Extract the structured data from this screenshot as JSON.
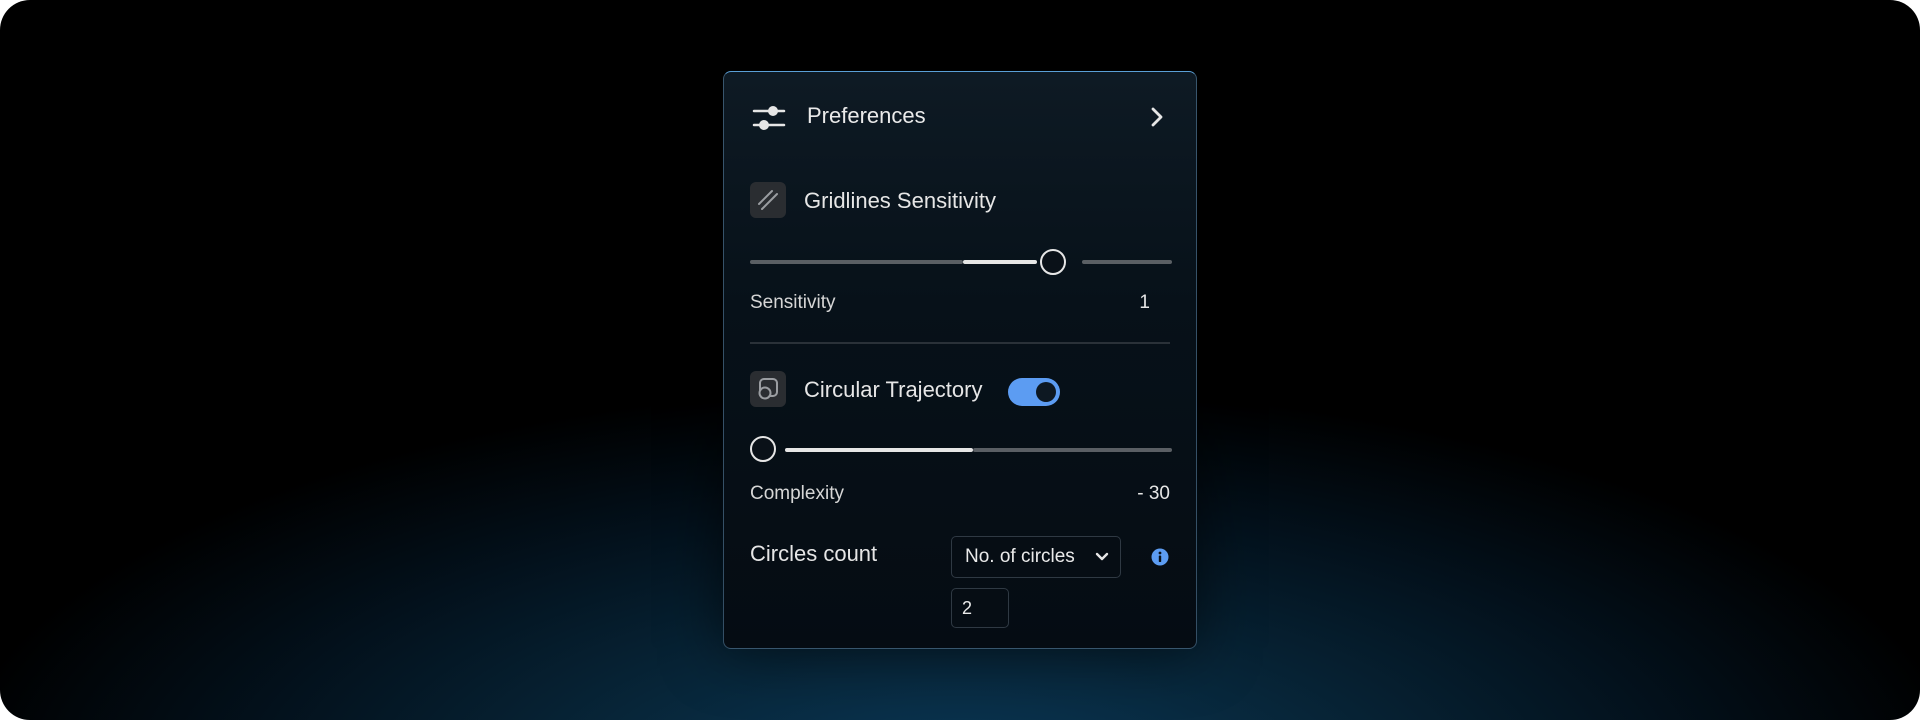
{
  "panel": {
    "title": "Preferences",
    "icons": {
      "header": "sliders-icon",
      "expand": "chevron-right-icon"
    }
  },
  "gridlines": {
    "title": "Gridlines Sensitivity",
    "icon": "diagonal-lines-icon",
    "slider_value_fraction": 0.74,
    "label": "Sensitivity",
    "value": "1"
  },
  "circular": {
    "title": "Circular Trajectory",
    "icon": "circle-square-icon",
    "toggle_on": true,
    "accent_color": "#5c9cf2",
    "slider_value_fraction": 0.0,
    "complexity_label": "Complexity",
    "complexity_value": "- 30",
    "count_label": "Circles count",
    "select": {
      "value": "No. of circles",
      "icon": "chevron-down-icon"
    },
    "info_icon": "info-icon",
    "count_input_value": "2"
  }
}
